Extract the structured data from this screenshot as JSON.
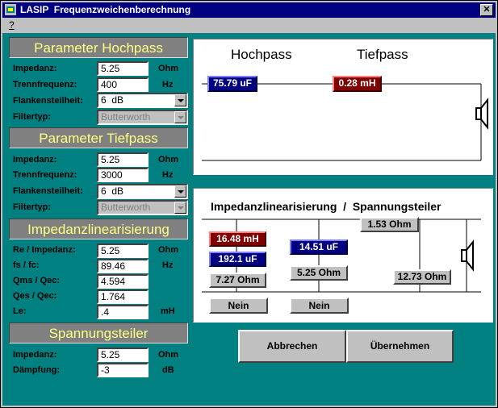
{
  "window": {
    "title": "LASIP  Frequenzweichenberechnung",
    "close_label": "✕"
  },
  "menu": {
    "help": "?"
  },
  "hochpass": {
    "header": "Parameter Hochpass",
    "impedance_label": "Impedanz:",
    "impedance_value": "5.25",
    "impedance_unit": "Ohm",
    "freq_label": "Trennfrequenz:",
    "freq_value": "400",
    "freq_unit": "Hz",
    "slope_label": "Flankensteilheit:",
    "slope_value": "6  dB",
    "filtertype_label": "Filtertyp:",
    "filtertype_value": "Butterworth"
  },
  "tiefpass": {
    "header": "Parameter Tiefpass",
    "impedance_label": "Impedanz:",
    "impedance_value": "5.25",
    "impedance_unit": "Ohm",
    "freq_label": "Trennfrequenz:",
    "freq_value": "3000",
    "freq_unit": "Hz",
    "slope_label": "Flankensteilheit:",
    "slope_value": "6  dB",
    "filtertype_label": "Filtertyp:",
    "filtertype_value": "Butterworth"
  },
  "linear": {
    "header": "Impedanzlinearisierung",
    "re_label": "Re / Impedanz:",
    "re_value": "5.25",
    "re_unit": "Ohm",
    "fs_label": "fs / fc:",
    "fs_value": "89.46",
    "fs_unit": "Hz",
    "qms_label": "Qms / Qec:",
    "qms_value": "4.594",
    "qes_label": "Qes / Qec:",
    "qes_value": "1.764",
    "le_label": "Le:",
    "le_value": ".4",
    "le_unit": "mH"
  },
  "divider": {
    "header": "Spannungsteiler",
    "impedance_label": "Impedanz:",
    "impedance_value": "5.25",
    "impedance_unit": "Ohm",
    "damping_label": "Dämpfung:",
    "damping_value": "-3",
    "damping_unit": "dB"
  },
  "circuit1": {
    "hp_title": "Hochpass",
    "tp_title": "Tiefpass",
    "capacitor": "75.79 uF",
    "inductor": "0.28 mH"
  },
  "circuit2": {
    "title": "Impedanzlinearisierung  /  Spannungsteiler",
    "l_value": "16.48 mH",
    "c1_value": "192.1 uF",
    "r1_value": "7.27 Ohm",
    "c2_value": "14.51 uF",
    "r2_value": "5.25 Ohm",
    "rs_value": "1.53 Ohm",
    "rp_value": "12.73 Ohm",
    "toggle1": "Nein",
    "toggle2": "Nein"
  },
  "buttons": {
    "cancel": "Abbrechen",
    "apply": "Übernehmen"
  },
  "colors": {
    "client_bg": "#008080",
    "header_text": "#ffff80",
    "titlebar": "#000080"
  }
}
